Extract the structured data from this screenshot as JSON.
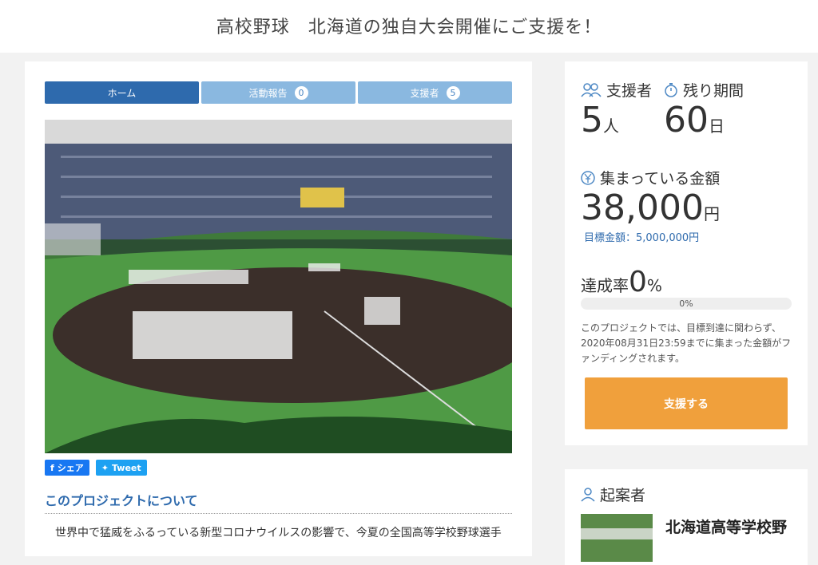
{
  "header": {
    "title": "高校野球　北海道の独自大会開催にご支援を！"
  },
  "tabs": [
    {
      "label": "ホーム",
      "count": null,
      "active": true
    },
    {
      "label": "活動報告",
      "count": "0",
      "active": false
    },
    {
      "label": "支援者",
      "count": "5",
      "active": false
    }
  ],
  "share": {
    "facebook_label": "シェア",
    "twitter_label": "Tweet"
  },
  "project": {
    "section_title": "このプロジェクトについて",
    "body_first_line": "世界中で猛威をふるっている新型コロナウイルスの影響で、今夏の全国高等学校野球選手"
  },
  "stats": {
    "supporters_label": "支援者",
    "supporters_value": "5",
    "supporters_unit": "人",
    "remaining_label": "残り期間",
    "remaining_value": "60",
    "remaining_unit": "日",
    "collected_label": "集まっている金額",
    "collected_value": "38,000",
    "collected_unit": "円",
    "goal_text": "目標金額：5,000,000円",
    "rate_label": "達成率",
    "rate_value": "0",
    "rate_unit": "%",
    "progress_text": "0%",
    "progress_fraction": 0,
    "note": "このプロジェクトでは、目標到達に関わらず、2020年08月31日23:59までに集まった金額がファンディングされます。",
    "support_button": "支援する"
  },
  "owner": {
    "label": "起案者",
    "name": "北海道高等学校野"
  },
  "colors": {
    "accent_blue": "#2e6aad",
    "tab_light": "#8ab8e0",
    "cta_orange": "#f0a03c"
  }
}
